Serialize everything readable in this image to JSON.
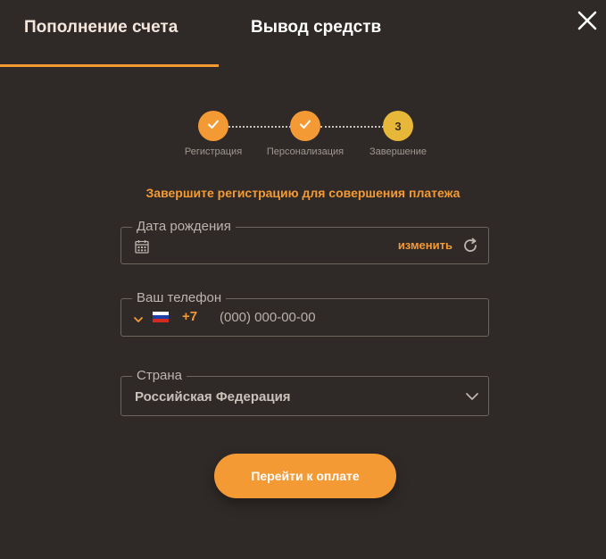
{
  "tabs": {
    "deposit": "Пополнение счета",
    "withdraw": "Вывод средств",
    "active": "deposit"
  },
  "steps": [
    {
      "label": "Регистрация",
      "status": "done",
      "number": "1"
    },
    {
      "label": "Персонализация",
      "status": "done",
      "number": "2"
    },
    {
      "label": "Завершение",
      "status": "current",
      "number": "3"
    }
  ],
  "notice": "Завершите регистрацию для совершения платежа",
  "birthdate": {
    "label": "Дата рождения",
    "value": "",
    "edit_label": "изменить"
  },
  "phone": {
    "label": "Ваш телефон",
    "country_code": "+7",
    "placeholder": "(000) 000-00-00",
    "value": ""
  },
  "country": {
    "label": "Страна",
    "selected": "Российская Федерация"
  },
  "pay_button": "Перейти к оплате",
  "colors": {
    "background": "#2f2a27",
    "accent": "#f39a35",
    "current_step": "#e7b73a",
    "border": "#6d655e"
  },
  "icons": {
    "close": "close-icon",
    "calendar": "calendar-icon",
    "refresh": "refresh-icon",
    "check": "check-icon",
    "chevron": "chevron-down-icon",
    "flag": "russia-flag-icon"
  }
}
